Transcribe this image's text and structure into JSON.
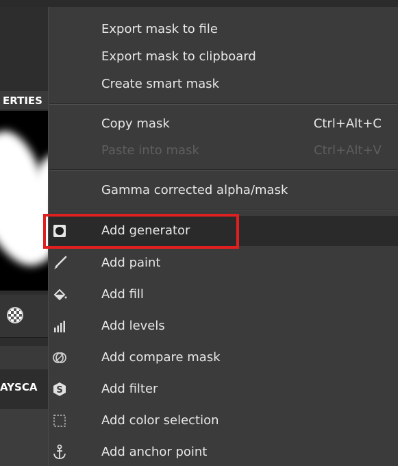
{
  "background_panel": {
    "properties_label": "ERTIES",
    "grayscale_label": "AYSCA"
  },
  "menu": {
    "items": [
      {
        "label": "Export mask to file",
        "shortcut": "",
        "icon": "",
        "disabled": false
      },
      {
        "label": "Export mask to clipboard",
        "shortcut": "",
        "icon": "",
        "disabled": false
      },
      {
        "label": "Create smart mask",
        "shortcut": "",
        "icon": "",
        "disabled": false
      },
      {
        "label": "Copy mask",
        "shortcut": "Ctrl+Alt+C",
        "icon": "",
        "disabled": false
      },
      {
        "label": "Paste into mask",
        "shortcut": "Ctrl+Alt+V",
        "icon": "",
        "disabled": true
      },
      {
        "label": "Gamma corrected alpha/mask",
        "shortcut": "",
        "icon": "",
        "disabled": false
      },
      {
        "label": "Add generator",
        "shortcut": "",
        "icon": "generator-icon",
        "disabled": false,
        "highlighted": true
      },
      {
        "label": "Add paint",
        "shortcut": "",
        "icon": "paint-brush-icon",
        "disabled": false
      },
      {
        "label": "Add fill",
        "shortcut": "",
        "icon": "paint-bucket-icon",
        "disabled": false
      },
      {
        "label": "Add levels",
        "shortcut": "",
        "icon": "levels-icon",
        "disabled": false
      },
      {
        "label": "Add compare mask",
        "shortcut": "",
        "icon": "compare-mask-icon",
        "disabled": false
      },
      {
        "label": "Add filter",
        "shortcut": "",
        "icon": "filter-icon",
        "disabled": false
      },
      {
        "label": "Add color selection",
        "shortcut": "",
        "icon": "color-selection-icon",
        "disabled": false
      },
      {
        "label": "Add anchor point",
        "shortcut": "",
        "icon": "anchor-icon",
        "disabled": false
      }
    ]
  },
  "colors": {
    "menu_bg": "#3b3b3b",
    "text": "#e8e8e8",
    "disabled_text": "#5e5e5e",
    "highlight_row": "#2a2a2a",
    "annotation_box": "#e02020"
  }
}
